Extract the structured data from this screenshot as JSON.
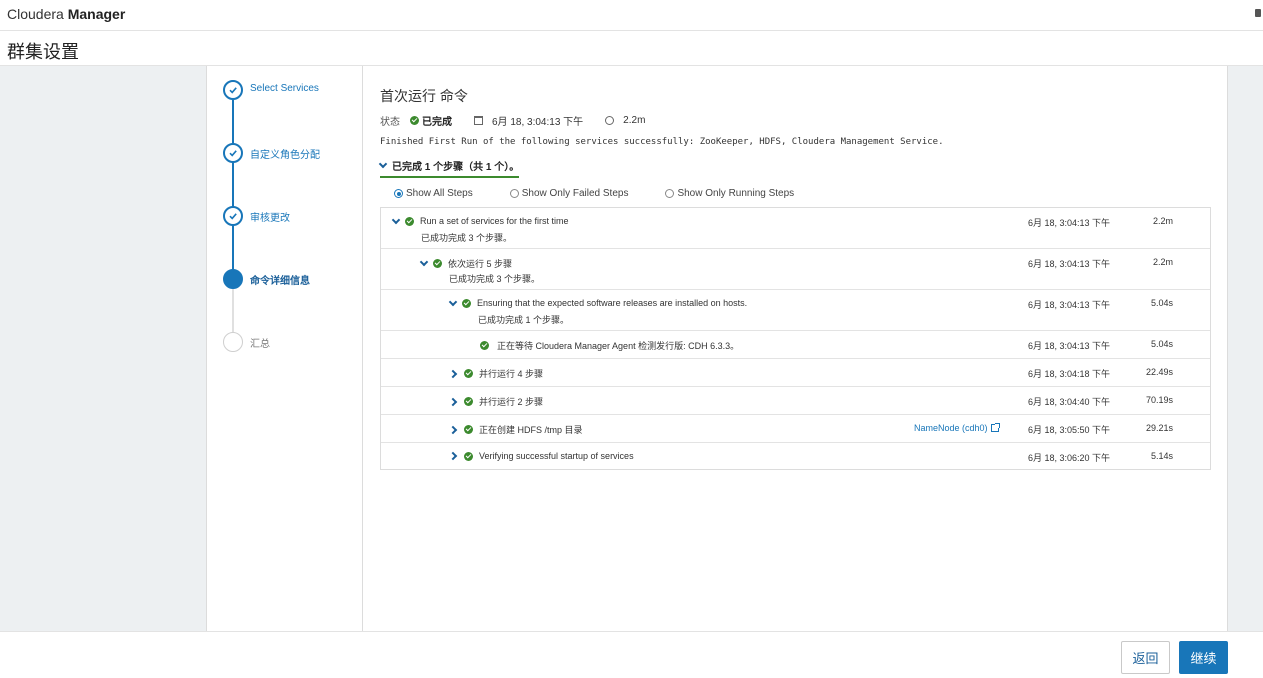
{
  "app": {
    "brand_light": "Cloudera",
    "brand_bold": "Manager"
  },
  "page": {
    "title": "群集设置"
  },
  "wizard": {
    "steps": [
      {
        "label": "Select Services",
        "state": "done"
      },
      {
        "label": "自定义角色分配",
        "state": "done"
      },
      {
        "label": "审核更改",
        "state": "done"
      },
      {
        "label": "命令详细信息",
        "state": "active"
      },
      {
        "label": "汇总",
        "state": "pending"
      }
    ]
  },
  "command": {
    "title": "首次运行 命令",
    "status_label": "状态",
    "status_value": "已完成",
    "date": "6月 18, 3:04:13 下午",
    "duration": "2.2m",
    "message": "Finished First Run of the following services successfully: ZooKeeper, HDFS, Cloudera Management Service.",
    "summary_toggle": "已完成 1 个步骤（共 1 个）。"
  },
  "filters": {
    "all": "Show All Steps",
    "failed": "Show Only Failed Steps",
    "running": "Show Only Running Steps",
    "selected": "all"
  },
  "step_rows": [
    {
      "name": "Run a set of services for the first time",
      "sub": "已成功完成  3  个步骤。",
      "date": "6月 18, 3:04:13 下午",
      "duration": "2.2m",
      "expanded": true,
      "link": ""
    },
    {
      "name": "依次运行 5 步骤",
      "sub": "已成功完成  3  个步骤。",
      "date": "6月 18, 3:04:13 下午",
      "duration": "2.2m",
      "expanded": true,
      "link": ""
    },
    {
      "name": "Ensuring that the expected software releases are installed on hosts.",
      "sub": "已成功完成  1  个步骤。",
      "date": "6月 18, 3:04:13 下午",
      "duration": "5.04s",
      "expanded": true,
      "link": ""
    },
    {
      "name": "正在等待 Cloudera Manager Agent 检测发行版: CDH 6.3.3。",
      "sub": "",
      "date": "6月 18, 3:04:13 下午",
      "duration": "5.04s",
      "expanded": null,
      "link": ""
    },
    {
      "name": "并行运行 4 步骤",
      "sub": "",
      "date": "6月 18, 3:04:18 下午",
      "duration": "22.49s",
      "expanded": false,
      "link": ""
    },
    {
      "name": "并行运行 2 步骤",
      "sub": "",
      "date": "6月 18, 3:04:40 下午",
      "duration": "70.19s",
      "expanded": false,
      "link": ""
    },
    {
      "name": "正在创建 HDFS /tmp 目录",
      "sub": "",
      "date": "6月 18, 3:05:50 下午",
      "duration": "29.21s",
      "expanded": false,
      "link": "NameNode (cdh0)"
    },
    {
      "name": "Verifying successful startup of services",
      "sub": "",
      "date": "6月 18, 3:06:20 下午",
      "duration": "5.14s",
      "expanded": false,
      "link": ""
    }
  ],
  "footer": {
    "back": "返回",
    "next": "继续"
  },
  "colors": {
    "accent": "#1876b9",
    "success": "#3c8a2e"
  }
}
